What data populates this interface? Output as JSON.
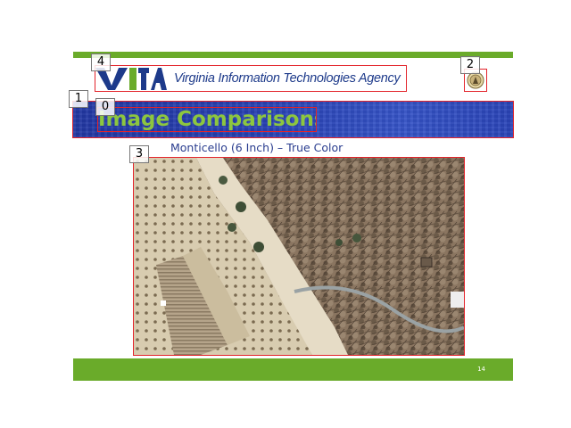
{
  "header": {
    "logo_text": "VITA",
    "agency_name": "Virginia Information Technologies Agency"
  },
  "title": "Image Comparisons",
  "caption": "Monticello (6 Inch) – True Color",
  "page_number": "14",
  "markers": [
    "0",
    "1",
    "2",
    "3",
    "4"
  ],
  "colors": {
    "accent_green": "#6aab2a",
    "title_green": "#8dc63f",
    "band_blue": "#2740b2",
    "agency_blue": "#1d3a8a",
    "marker_red": "#e3242b"
  },
  "icons": {
    "logo": "vita-logo-icon",
    "seal": "commonwealth-seal-icon",
    "photo": "aerial-photo-image"
  }
}
